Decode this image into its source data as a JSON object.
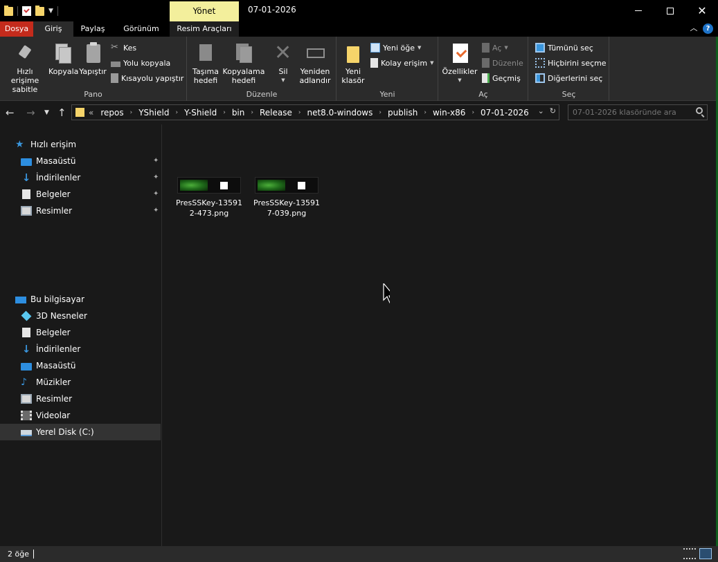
{
  "window": {
    "title": "07-01-2026",
    "contextual_tab_header": "Yönet",
    "controls": {
      "minimize": "",
      "maximize": "",
      "close": "✕"
    }
  },
  "tabs": {
    "file": "Dosya",
    "home": "Giriş",
    "share": "Paylaş",
    "view": "Görünüm",
    "picture_tools": "Resim Araçları"
  },
  "ribbon": {
    "clipboard": {
      "label": "Pano",
      "pin_line1": "Hızlı erişime",
      "pin_line2": "sabitle",
      "copy": "Kopyala",
      "paste": "Yapıştır",
      "cut": "Kes",
      "copy_path": "Yolu kopyala",
      "paste_shortcut": "Kısayolu yapıştır"
    },
    "organize": {
      "label": "Düzenle",
      "move_line1": "Taşıma",
      "move_line2": "hedefi",
      "copyto_line1": "Kopyalama",
      "copyto_line2": "hedefi",
      "delete": "Sil",
      "rename_line1": "Yeniden",
      "rename_line2": "adlandır"
    },
    "new": {
      "label": "Yeni",
      "newfolder_line1": "Yeni",
      "newfolder_line2": "klasör",
      "new_item": "Yeni öğe",
      "easy_access": "Kolay erişim"
    },
    "open": {
      "label": "Aç",
      "properties": "Özellikler",
      "open": "Aç",
      "edit": "Düzenle",
      "history": "Geçmiş"
    },
    "select": {
      "label": "Seç",
      "select_all": "Tümünü seç",
      "select_none": "Hiçbirini seçme",
      "invert": "Diğerlerini seç"
    }
  },
  "address": {
    "overflow": "«",
    "crumbs": [
      "repos",
      "YShield",
      "Y-Shield",
      "bin",
      "Release",
      "net8.0-windows",
      "publish",
      "win-x86",
      "07-01-2026"
    ]
  },
  "search": {
    "placeholder": "07-01-2026 klasöründe ara"
  },
  "navpane": {
    "quick_access": {
      "title": "Hızlı erişim",
      "items": [
        "Masaüstü",
        "İndirilenler",
        "Belgeler",
        "Resimler"
      ]
    },
    "this_pc": {
      "title": "Bu bilgisayar",
      "items": [
        "3D Nesneler",
        "Belgeler",
        "İndirilenler",
        "Masaüstü",
        "Müzikler",
        "Resimler",
        "Videolar",
        "Yerel Disk (C:)"
      ]
    }
  },
  "files": [
    {
      "line1": "PresSSKey-13591",
      "line2": "2-473.png"
    },
    {
      "line1": "PresSSKey-13591",
      "line2": "7-039.png"
    }
  ],
  "status": {
    "count": "2 öğe"
  },
  "colors": {
    "file_tab": "#c42b1c",
    "contextual": "#f3ef9c",
    "accent": "#3a96dd"
  }
}
